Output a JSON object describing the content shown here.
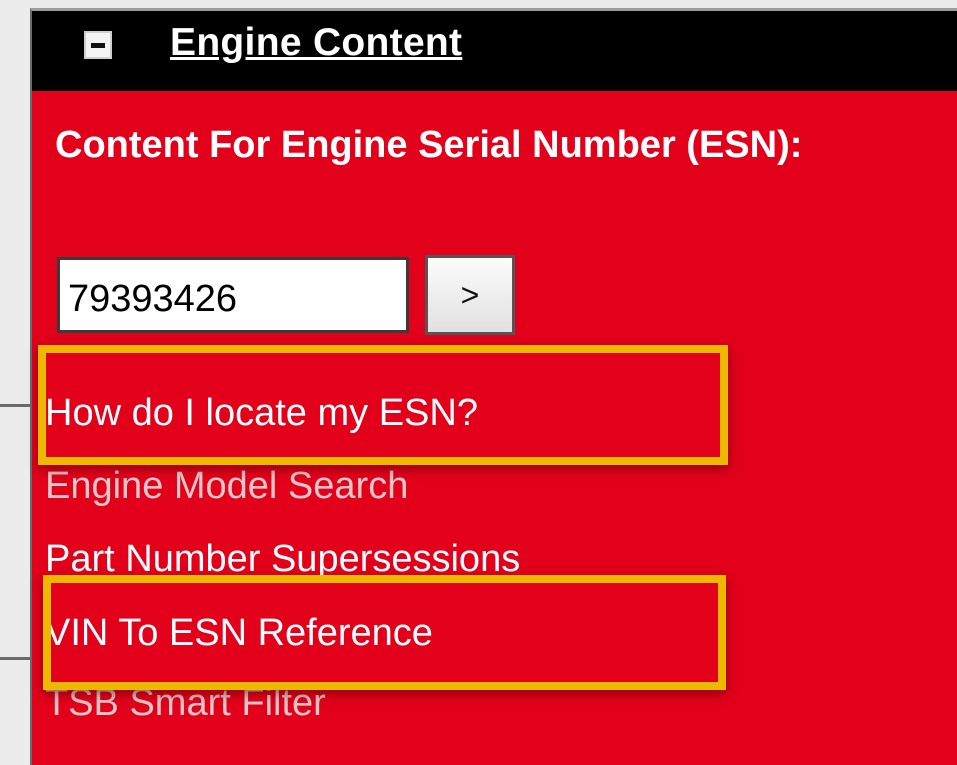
{
  "panel": {
    "title": "Engine Content",
    "esn_label": "Content For Engine Serial Number (ESN):",
    "esn_value": "79393426",
    "go_button": ">",
    "links": [
      "How do I locate my ESN?",
      "Engine Model Search",
      "Part Number Supersessions",
      "VIN To ESN Reference",
      "TSB Smart Filter"
    ]
  },
  "colors": {
    "panel_background": "#e2001b",
    "header_background": "#000000",
    "highlight": "#ecb800"
  },
  "icons": {
    "collapse": "collapse-minus-icon"
  }
}
